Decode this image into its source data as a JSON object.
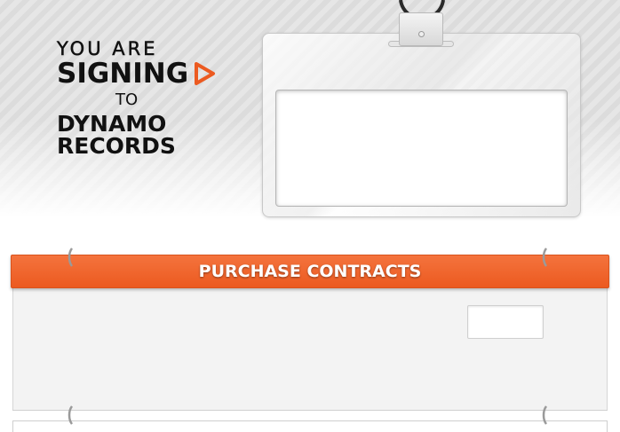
{
  "headline": {
    "line1": "YOU ARE",
    "line2": "SIGNING",
    "line3": "TO",
    "line4": "DYNAMO",
    "line5": "RECORDS"
  },
  "badge": {
    "name_value": ""
  },
  "contracts": {
    "title": "PURCHASE CONTRACTS",
    "input_value": ""
  },
  "colors": {
    "accent": "#ec5a20",
    "text": "#111111",
    "panel": "#f3f3f3"
  },
  "icons": {
    "play": "play-icon",
    "ring": "binder-ring-icon"
  }
}
